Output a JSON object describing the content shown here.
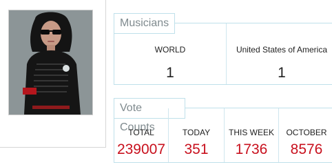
{
  "musicians": {
    "title": "Musicians",
    "columns": [
      {
        "label": "WORLD",
        "value": "1"
      },
      {
        "label": "United States of America",
        "value": "1"
      }
    ]
  },
  "vote_counts": {
    "title": "Vote Counts",
    "columns": [
      {
        "label": "TOTAL",
        "value": "239007"
      },
      {
        "label": "TODAY",
        "value": "351"
      },
      {
        "label": "THIS WEEK",
        "value": "1736"
      },
      {
        "label": "OCTOBER",
        "value": "8576"
      }
    ]
  },
  "colors": {
    "panel_border": "#bfe0ea",
    "vote_value": "#c8101d",
    "tab_text": "#7f8a8e"
  }
}
